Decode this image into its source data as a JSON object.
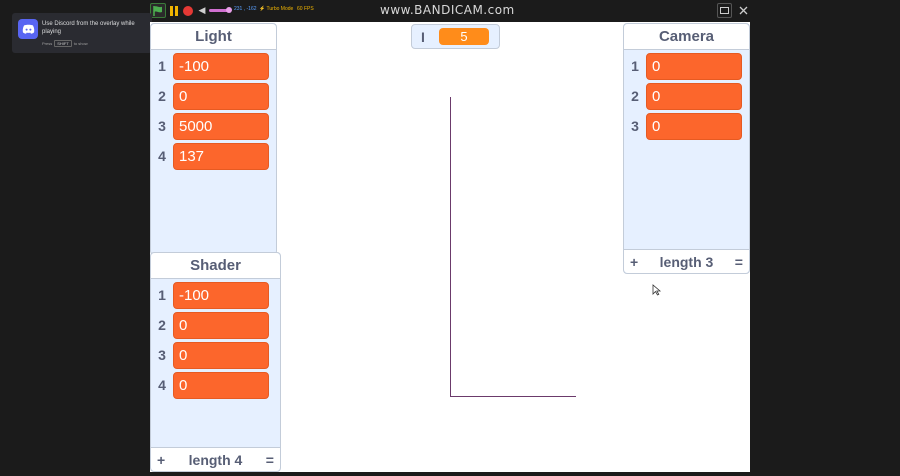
{
  "toolbar": {
    "coords": "231 , -162",
    "turbo": "Turbo Mode",
    "fps": "60 FPS",
    "watermark": "www.BANDICAM.com"
  },
  "discord": {
    "message": "Use Discord from the overlay while playing",
    "hint_prefix": "Press",
    "hint_key": "SHIFT",
    "hint_suffix": "to show"
  },
  "variable": {
    "name": "I",
    "value": "5"
  },
  "lists": {
    "light": {
      "title": "Light",
      "items": [
        "-100",
        "0",
        "5000",
        "137"
      ]
    },
    "shader": {
      "title": "Shader",
      "items": [
        "-100",
        "0",
        "0",
        "0"
      ],
      "plus": "+",
      "length": "length 4",
      "eq": "="
    },
    "camera": {
      "title": "Camera",
      "items": [
        "0",
        "0",
        "0"
      ],
      "plus": "+",
      "length": "length 3",
      "eq": "="
    }
  },
  "indices": [
    "1",
    "2",
    "3",
    "4"
  ],
  "colors": {
    "list_item": "#fc662c",
    "variable": "#ff8c1a",
    "pen": "#6b3a6b"
  }
}
